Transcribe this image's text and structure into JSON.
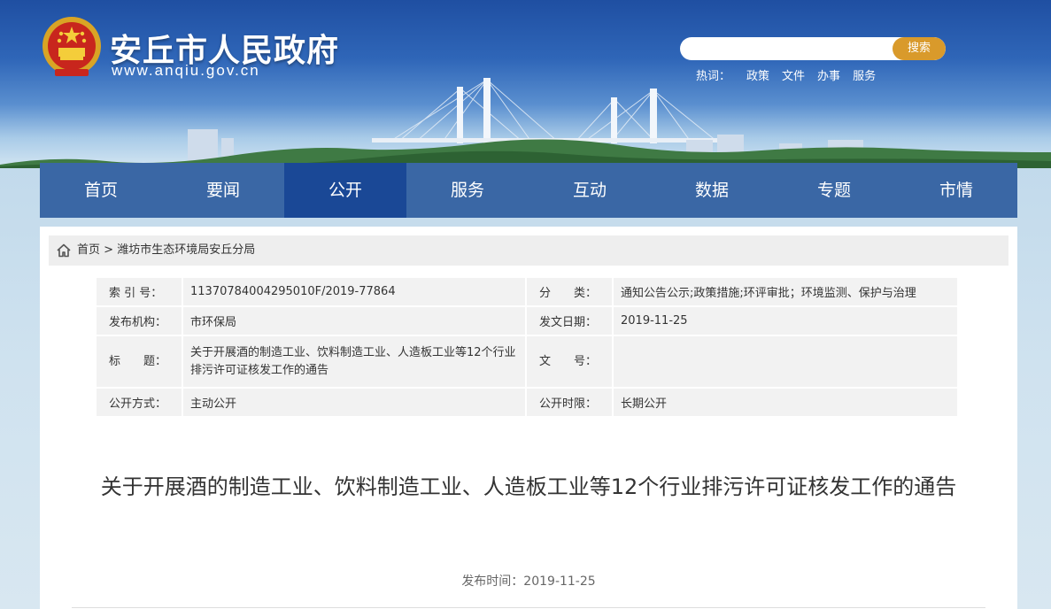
{
  "site": {
    "name": "安丘市人民政府",
    "url": "www.anqiu.gov.cn"
  },
  "search": {
    "placeholder": "",
    "button_label": "搜索"
  },
  "hot": {
    "label": "热词：",
    "items": [
      "政策",
      "文件",
      "办事",
      "服务"
    ]
  },
  "nav": {
    "items": [
      "首页",
      "要闻",
      "公开",
      "服务",
      "互动",
      "数据",
      "专题",
      "市情"
    ],
    "active_index": 2
  },
  "breadcrumb": {
    "home": "首页",
    "separator": ">",
    "current": "潍坊市生态环境局安丘分局"
  },
  "meta": {
    "index_label": "索 引 号：",
    "index_value": "11370784004295010F/2019-77864",
    "category_label": "分　　类：",
    "category_value": "通知公告公示;政策措施;环评审批；环境监测、保护与治理",
    "publisher_label": "发布机构：",
    "publisher_value": "市环保局",
    "date_label": "发文日期：",
    "date_value": "2019-11-25",
    "title_label": "标　　题：",
    "title_value": "关于开展酒的制造工业、饮料制造工业、人造板工业等12个行业排污许可证核发工作的通告",
    "doc_no_label": "文　　号：",
    "doc_no_value": "",
    "open_mode_label": "公开方式：",
    "open_mode_value": "主动公开",
    "open_period_label": "公开时限：",
    "open_period_value": "长期公开"
  },
  "article": {
    "title": "关于开展酒的制造工业、饮料制造工业、人造板工业等12个行业排污许可证核发工作的通告",
    "pub_time": "发布时间：2019-11-25"
  },
  "colors": {
    "nav_bg": "#3a67a5",
    "nav_active": "#1a4896",
    "search_button": "#d99a2b"
  }
}
